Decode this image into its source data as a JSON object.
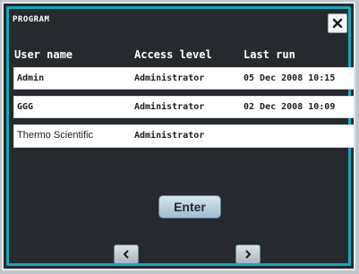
{
  "window": {
    "title": "PROGRAM"
  },
  "icons": {
    "close": "close-icon",
    "prev": "chevron-left-icon",
    "next": "chevron-right-icon"
  },
  "table": {
    "headers": [
      "User name",
      "Access level",
      "Last run"
    ],
    "rows": [
      {
        "user": "Admin",
        "access": "Administrator",
        "last_run": "05 Dec 2008 10:15"
      },
      {
        "user": "GGG",
        "access": "Administrator",
        "last_run": "02 Dec 2008 10:09"
      },
      {
        "user": "Thermo Scientific",
        "access": "Administrator",
        "last_run": ""
      }
    ]
  },
  "buttons": {
    "enter": "Enter"
  },
  "colors": {
    "background": "#262a2f",
    "frame": "#1aa7b8",
    "row_bg": "#ffffff"
  }
}
